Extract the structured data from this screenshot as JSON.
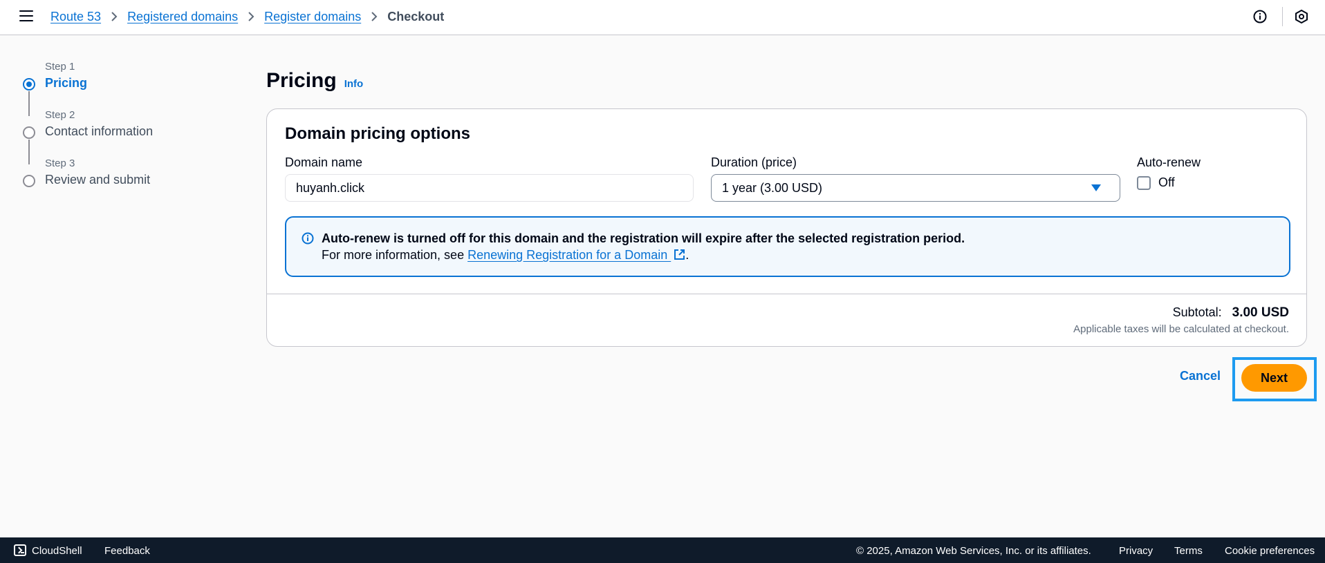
{
  "breadcrumb": {
    "items": [
      "Route 53",
      "Registered domains",
      "Register domains"
    ],
    "current": "Checkout"
  },
  "steps": [
    {
      "num": "Step 1",
      "title": "Pricing",
      "active": true
    },
    {
      "num": "Step 2",
      "title": "Contact information",
      "active": false
    },
    {
      "num": "Step 3",
      "title": "Review and submit",
      "active": false
    }
  ],
  "page": {
    "title": "Pricing",
    "info_label": "Info"
  },
  "card": {
    "title": "Domain pricing options",
    "domain_label": "Domain name",
    "domain_value": "huyanh.click",
    "duration_label": "Duration (price)",
    "duration_value": "1 year (3.00 USD)",
    "autorenew_label": "Auto-renew",
    "autorenew_checkbox_label": "Off",
    "autorenew_checked": false
  },
  "alert": {
    "title": "Auto-renew is turned off for this domain and the registration will expire after the selected registration period.",
    "body_prefix": "For more information, see ",
    "link_text": "Renewing Registration for a Domain ",
    "body_suffix": "."
  },
  "subtotal": {
    "label": "Subtotal:",
    "value": "3.00 USD",
    "tax_note": "Applicable taxes will be calculated at checkout."
  },
  "actions": {
    "cancel_label": "Cancel",
    "next_label": "Next"
  },
  "footer": {
    "cloudshell": "CloudShell",
    "feedback": "Feedback",
    "copyright": "© 2025, Amazon Web Services, Inc. or its affiliates.",
    "privacy": "Privacy",
    "terms": "Terms",
    "cookies": "Cookie preferences"
  },
  "colors": {
    "link": "#0972d3",
    "primary_button": "#ff9900",
    "footer_bg": "#0f1b2a",
    "highlight": "#1d9bf0"
  }
}
